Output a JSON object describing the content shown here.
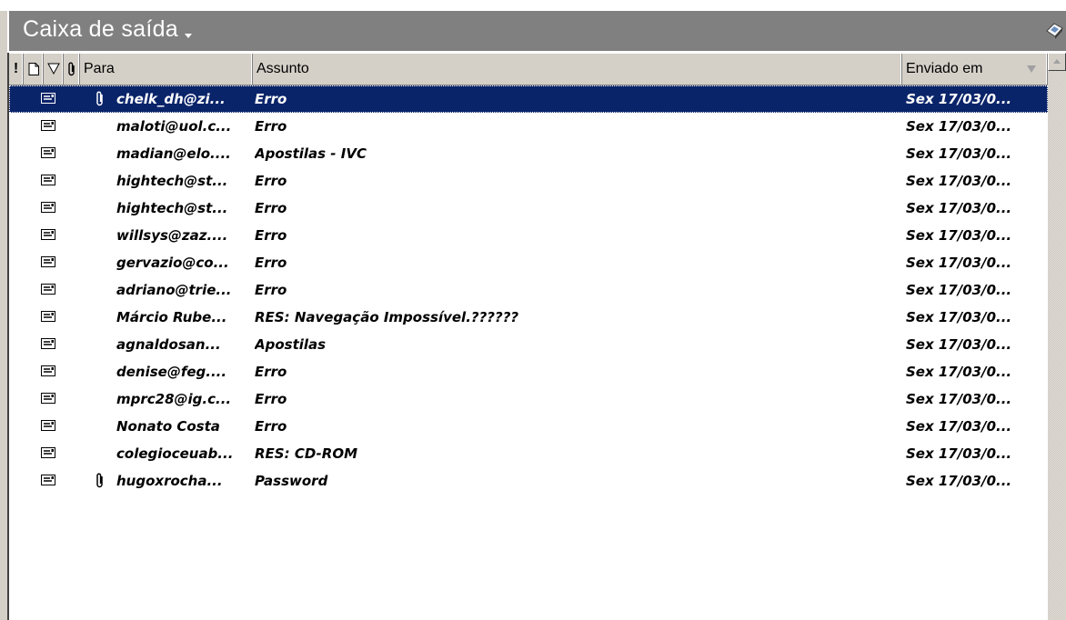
{
  "folder": {
    "title": "Caixa de saída",
    "title_icon": "chevron-down-icon",
    "corner_icon": "outlook-shortcut-icon"
  },
  "columns": {
    "importance": "!",
    "icon": "document-icon",
    "flag": "flag-icon",
    "attachment": "paperclip-icon",
    "para": "Para",
    "assunto": "Assunto",
    "enviado": "Enviado em",
    "sort": "sort-descending-icon"
  },
  "messages": [
    {
      "para": "chelk_dh@zi...",
      "assunto": "Erro",
      "enviado": "Sex 17/03/0...",
      "attachment": true,
      "selected": true
    },
    {
      "para": "maloti@uol.c...",
      "assunto": "Erro",
      "enviado": "Sex 17/03/0...",
      "attachment": false
    },
    {
      "para": "madian@elo....",
      "assunto": "Apostilas - IVC",
      "enviado": "Sex 17/03/0...",
      "attachment": false
    },
    {
      "para": "hightech@st...",
      "assunto": "Erro",
      "enviado": "Sex 17/03/0...",
      "attachment": false
    },
    {
      "para": "hightech@st...",
      "assunto": "Erro",
      "enviado": "Sex 17/03/0...",
      "attachment": false
    },
    {
      "para": "willsys@zaz....",
      "assunto": "Erro",
      "enviado": "Sex 17/03/0...",
      "attachment": false
    },
    {
      "para": "gervazio@co...",
      "assunto": "Erro",
      "enviado": "Sex 17/03/0...",
      "attachment": false
    },
    {
      "para": "adriano@trie...",
      "assunto": "Erro",
      "enviado": "Sex 17/03/0...",
      "attachment": false
    },
    {
      "para": "Márcio Rube...",
      "assunto": "RES: Navegação Impossível.??????",
      "enviado": "Sex 17/03/0...",
      "attachment": false
    },
    {
      "para": "agnaldosan...",
      "assunto": "Apostilas",
      "enviado": "Sex 17/03/0...",
      "attachment": false
    },
    {
      "para": "denise@feg....",
      "assunto": "Erro",
      "enviado": "Sex 17/03/0...",
      "attachment": false
    },
    {
      "para": "mprc28@ig.c...",
      "assunto": "Erro",
      "enviado": "Sex 17/03/0...",
      "attachment": false
    },
    {
      "para": "Nonato Costa",
      "assunto": "Erro",
      "enviado": "Sex 17/03/0...",
      "attachment": false
    },
    {
      "para": "colegioceuab...",
      "assunto": "RES: CD-ROM",
      "enviado": "Sex 17/03/0...",
      "attachment": false
    },
    {
      "para": "hugoxrocha...",
      "assunto": "Password",
      "enviado": "Sex 17/03/0...",
      "attachment": true
    }
  ],
  "colors": {
    "selected_bg": "#0a246a",
    "banner_bg": "#808080",
    "chrome": "#d4d0c8"
  }
}
